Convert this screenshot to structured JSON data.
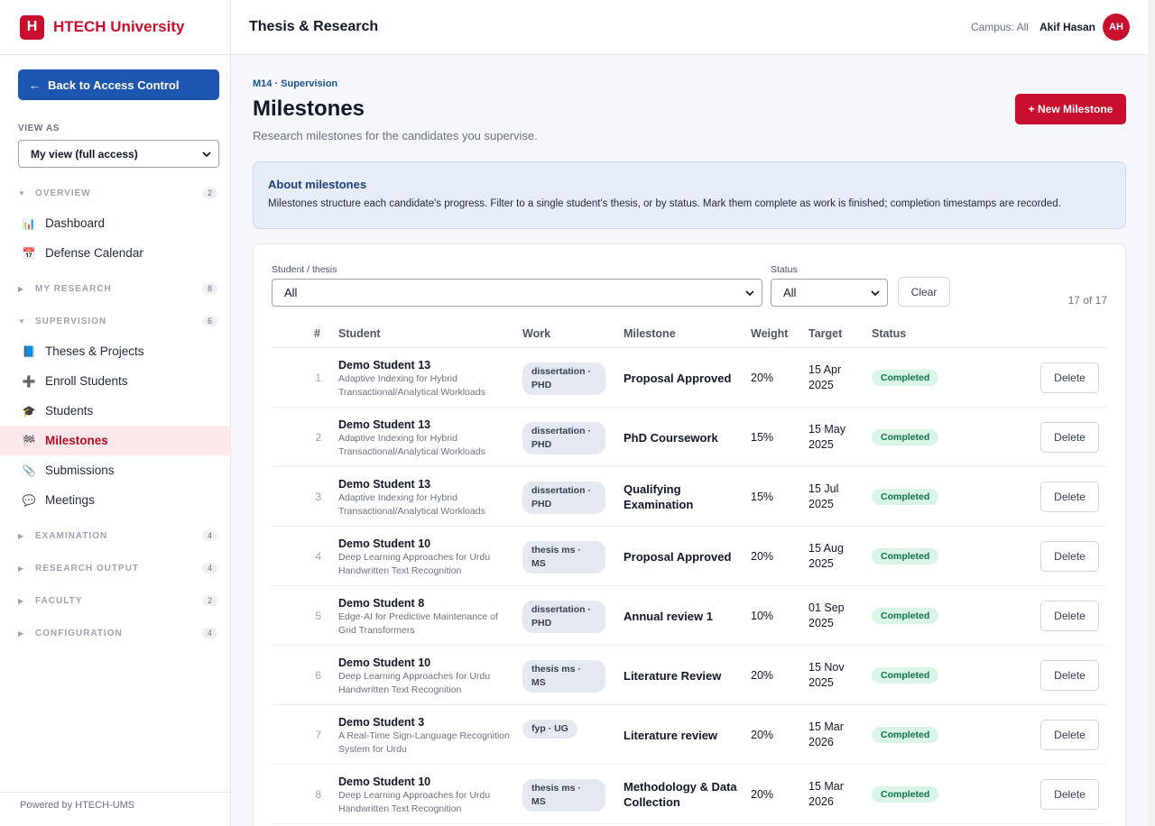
{
  "brand": {
    "logo_letter": "H",
    "name": "HTECH University"
  },
  "sidebar": {
    "back_label": "Back to Access Control",
    "back_arrow": "←",
    "view_as_label": "VIEW AS",
    "view_as_value": "My view (full access)",
    "sections": [
      {
        "label": "OVERVIEW",
        "count": "2",
        "expanded": true,
        "items": [
          {
            "label": "Dashboard",
            "icon": "bar-chart-icon",
            "glyph": "📊"
          },
          {
            "label": "Defense Calendar",
            "icon": "calendar-icon",
            "glyph": "📅"
          }
        ]
      },
      {
        "label": "MY RESEARCH",
        "count": "8",
        "expanded": false,
        "items": []
      },
      {
        "label": "SUPERVISION",
        "count": "6",
        "expanded": true,
        "items": [
          {
            "label": "Theses & Projects",
            "icon": "book-icon",
            "glyph": "📘"
          },
          {
            "label": "Enroll Students",
            "icon": "plus-icon",
            "glyph": "➕"
          },
          {
            "label": "Students",
            "icon": "graduation-cap-icon",
            "glyph": "🎓"
          },
          {
            "label": "Milestones",
            "icon": "checkered-flag-icon",
            "glyph": "🏁",
            "active": true
          },
          {
            "label": "Submissions",
            "icon": "paperclip-icon",
            "glyph": "📎"
          },
          {
            "label": "Meetings",
            "icon": "speech-bubble-icon",
            "glyph": "💬"
          }
        ]
      },
      {
        "label": "EXAMINATION",
        "count": "4",
        "expanded": false,
        "items": []
      },
      {
        "label": "RESEARCH OUTPUT",
        "count": "4",
        "expanded": false,
        "items": []
      },
      {
        "label": "FACULTY",
        "count": "2",
        "expanded": false,
        "items": []
      },
      {
        "label": "CONFIGURATION",
        "count": "4",
        "expanded": false,
        "items": []
      }
    ],
    "powered_by": "Powered by HTECH-UMS"
  },
  "topbar": {
    "title": "Thesis & Research",
    "campus": "Campus: All",
    "user_name": "Akif Hasan",
    "user_initials": "AH"
  },
  "page": {
    "breadcrumb": "M14 · Supervision",
    "title": "Milestones",
    "subtitle": "Research milestones for the candidates you supervise.",
    "new_button": "+ New Milestone"
  },
  "about": {
    "title": "About milestones",
    "text": "Milestones structure each candidate's progress. Filter to a single student's thesis, or by status. Mark them complete as work is finished; completion timestamps are recorded."
  },
  "filters": {
    "student_label": "Student / thesis",
    "student_value": "All",
    "status_label": "Status",
    "status_value": "All",
    "clear_label": "Clear",
    "result_count": "17 of 17"
  },
  "table": {
    "headers": {
      "num": "#",
      "student": "Student",
      "work": "Work",
      "milestone": "Milestone",
      "weight": "Weight",
      "target": "Target",
      "status": "Status"
    },
    "delete_label": "Delete",
    "rows": [
      {
        "num": "1",
        "student": "Demo Student 13",
        "thesis": "Adaptive Indexing for Hybrid Transactional/Analytical Workloads",
        "work": "dissertation · PHD",
        "milestone": "Proposal Approved",
        "weight": "20%",
        "target": "15 Apr 2025",
        "status": "Completed"
      },
      {
        "num": "2",
        "student": "Demo Student 13",
        "thesis": "Adaptive Indexing for Hybrid Transactional/Analytical Workloads",
        "work": "dissertation · PHD",
        "milestone": "PhD Coursework",
        "weight": "15%",
        "target": "15 May 2025",
        "status": "Completed"
      },
      {
        "num": "3",
        "student": "Demo Student 13",
        "thesis": "Adaptive Indexing for Hybrid Transactional/Analytical Workloads",
        "work": "dissertation · PHD",
        "milestone": "Qualifying Examination",
        "weight": "15%",
        "target": "15 Jul 2025",
        "status": "Completed"
      },
      {
        "num": "4",
        "student": "Demo Student 10",
        "thesis": "Deep Learning Approaches for Urdu Handwritten Text Recognition",
        "work": "thesis ms · MS",
        "milestone": "Proposal Approved",
        "weight": "20%",
        "target": "15 Aug 2025",
        "status": "Completed"
      },
      {
        "num": "5",
        "student": "Demo Student 8",
        "thesis": "Edge-AI for Predictive Maintenance of Grid Transformers",
        "work": "dissertation · PHD",
        "milestone": "Annual review 1",
        "weight": "10%",
        "target": "01 Sep 2025",
        "status": "Completed"
      },
      {
        "num": "6",
        "student": "Demo Student 10",
        "thesis": "Deep Learning Approaches for Urdu Handwritten Text Recognition",
        "work": "thesis ms · MS",
        "milestone": "Literature Review",
        "weight": "20%",
        "target": "15 Nov 2025",
        "status": "Completed"
      },
      {
        "num": "7",
        "student": "Demo Student 3",
        "thesis": "A Real-Time Sign-Language Recognition System for Urdu",
        "work": "fyp · UG",
        "milestone": "Literature review",
        "weight": "20%",
        "target": "15 Mar 2026",
        "status": "Completed"
      },
      {
        "num": "8",
        "student": "Demo Student 10",
        "thesis": "Deep Learning Approaches for Urdu Handwritten Text Recognition",
        "work": "thesis ms · MS",
        "milestone": "Methodology & Data Collection",
        "weight": "20%",
        "target": "15 Mar 2026",
        "status": "Completed"
      }
    ]
  }
}
